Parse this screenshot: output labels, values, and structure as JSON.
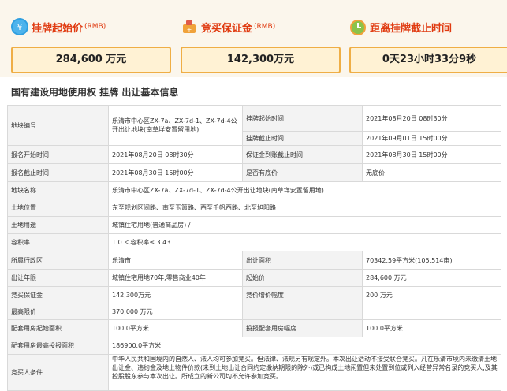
{
  "summary": {
    "start_price": {
      "title": "挂牌起始价",
      "unit_tag": "(RMB)",
      "value": "284,600 万元",
      "icon": "money-icon"
    },
    "deposit": {
      "title": "竞买保证金",
      "unit_tag": "(RMB)",
      "value": "142,300万元",
      "icon": "deposit-icon"
    },
    "countdown": {
      "title": "距离挂牌截止时间",
      "value": "0天23小时33分9秒",
      "icon": "clock-icon"
    }
  },
  "section": {
    "title": "国有建设用地使用权 挂牌 出让基本信息"
  },
  "details": {
    "parcel_no": {
      "label": "地块编号",
      "value": "乐清市中心区ZX-7a、ZX-7d-1、ZX-7d-4公开出让地块(南草垟安置留用地)"
    },
    "listing_start": {
      "label": "挂牌起始时间",
      "value": "2021年08月20日 08时30分"
    },
    "listing_end": {
      "label": "挂牌截止时间",
      "value": "2021年09月01日 15时00分"
    },
    "reg_start": {
      "label": "报名开始时间",
      "value": "2021年08月20日 08时30分"
    },
    "deposit_deadline": {
      "label": "保证金到账截止时间",
      "value": "2021年08月30日 15时00分"
    },
    "reg_end": {
      "label": "报名截止时间",
      "value": "2021年08月30日 15时00分"
    },
    "reserve": {
      "label": "是否有底价",
      "value": "无底价"
    },
    "parcel_name": {
      "label": "地块名称",
      "value": "乐清市中心区ZX-7a、ZX-7d-1、ZX-7d-4公开出让地块(南草垟安置留用地)"
    },
    "location": {
      "label": "土地位置",
      "value": "东至规划区间路、南至玉箫路、西至千帆西路、北至旭阳路"
    },
    "use": {
      "label": "土地用途",
      "value": "城镇住宅用地(普通商品房) /"
    },
    "far": {
      "label": "容积率",
      "value": "1.0 ＜容积率≤ 3.43"
    },
    "district": {
      "label": "所属行政区",
      "value": "乐清市"
    },
    "area": {
      "label": "出让面积",
      "value": "70342.59平方米(105.514亩)"
    },
    "term": {
      "label": "出让年限",
      "value": "城镇住宅用地70年,零售商业40年"
    },
    "start_price": {
      "label": "起始价",
      "value": "284,600 万元"
    },
    "deposit": {
      "label": "竞买保证金",
      "value": "142,300万元"
    },
    "increment": {
      "label": "竞价增价幅度",
      "value": "200 万元"
    },
    "max_price": {
      "label": "最高限价",
      "value": "370,000 万元"
    },
    "housing_start": {
      "label": "配套用房起始面积",
      "value": "100.0平方米"
    },
    "housing_increment": {
      "label": "投报配套用房幅度",
      "value": "100.0平方米"
    },
    "housing_max": {
      "label": "配套用房最高投报面积",
      "value": "186900.0平方米"
    },
    "conditions": {
      "label": "竞买人条件",
      "value": "中华人民共和国境内的自然人、法人均可参加竞买。但法律、法规另有规定外。本次出让活动不接受联合竞买。凡在乐清市境内未缴清土地出让金、违约金及地上物件价款(未到土地出让合同约定缴纳期限的除外)或已构成土地闲置但未处置到位或列入经营异常名录的竞买人,及其控股股东参与本次出让。所成立的新公司均不允许参加竞买。"
    }
  },
  "colors": {
    "accent": "#e03a10",
    "value_border": "#efae45",
    "value_bg": "#fff2d4",
    "header_bg": "#fbf6ec"
  }
}
